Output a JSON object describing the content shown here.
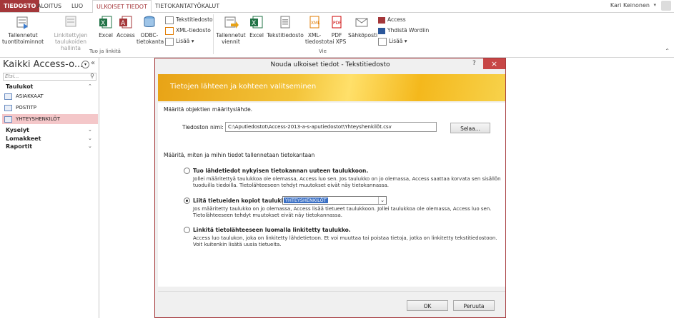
{
  "tabs": [
    "TIEDOSTO",
    "ALOITUS",
    "LUO",
    "ULKOISET TIEDOT",
    "TIETOKANTATYÖKALUT"
  ],
  "user": "Kari Keinonen",
  "ribbon": {
    "import_group": "Tuo ja linkitä",
    "export_group": "Vie",
    "saved_imports": [
      "Tallennetut",
      "tuontitoiminnot"
    ],
    "linked_mgr": [
      "Linkitettyjen",
      "taulukoiden hallinta"
    ],
    "excel": "Excel",
    "access": "Access",
    "odbc": [
      "ODBC-",
      "tietokanta"
    ],
    "text_file": "Tekstitiedosto",
    "xml_file": "XML-tiedosto",
    "more": "Lisää",
    "saved_exports": [
      "Tallennetut",
      "viennit"
    ],
    "exp_excel": "Excel",
    "exp_text": "Tekstitiedosto",
    "exp_xml": [
      "XML-",
      "tiedosto"
    ],
    "exp_pdf": [
      "PDF",
      "tai XPS"
    ],
    "exp_email": "Sähköposti",
    "exp_access": "Access",
    "exp_word": "Yhdistä Wordiin",
    "exp_more": "Lisää"
  },
  "nav": {
    "title": "Kaikki Access-o...",
    "search_placeholder": "Etsi...",
    "tables_header": "Taulukot",
    "tables": [
      "ASIAKKAAT",
      "POSTITP",
      "YHTEYSHENKILÖT"
    ],
    "queries": "Kyselyt",
    "forms": "Lomakkeet",
    "reports": "Raportit"
  },
  "dialog": {
    "title": "Nouda ulkoiset tiedot - Tekstitiedosto",
    "help": "?",
    "close": "×",
    "banner": "Tietojen lähteen ja kohteen valitseminen",
    "source_heading": "Määritä objektien määrityslähde.",
    "filename_label": "Tiedoston nimi:",
    "filename_value": "C:\\Aputiedostot\\Access-2013-a-s-aputiedostot\\Yhteyshenkilöt.csv",
    "browse": "Selaa...",
    "store_heading": "Määritä, miten ja mihin tiedot tallennetaan tietokantaan",
    "opt1_label": "Tuo lähdetiedot nykyisen tietokannan uuteen taulukkoon.",
    "opt1_desc": [
      "Jollei määritettyä taulukkoa ole olemassa, Access luo sen. Jos taulukko on jo olemassa, Access saattaa korvata sen sisällön",
      "tuoduilla tiedoilla. Tietolähteeseen tehdyt muutokset eivät näy tietokannassa."
    ],
    "opt2_label": "Liitä tietueiden kopiot taulukkoon:",
    "opt2_table": "YHTEYSHENKILÖT",
    "opt2_desc": [
      "Jos määritetty taulukko on jo olemassa, Access lisää tietueet taulukkoon. Jollei taulukkoa ole olemassa, Access luo sen.",
      "Tietolähteeseen tehdyt muutokset eivät näy tietokannassa."
    ],
    "opt3_label": "Linkitä tietolähteeseen luomalla linkitetty taulukko.",
    "opt3_desc": [
      "Access luo taulukon, joka on linkitetty lähdetietoon. Et voi muuttaa tai poistaa tietoja, jotka on linkitetty tekstitiedostoon.",
      "Voit kuitenkin lisätä uusia tietueita."
    ],
    "ok": "OK",
    "cancel": "Peruuta"
  },
  "colors": {
    "accent": "#a4373a",
    "banner": "#f3c43a"
  }
}
